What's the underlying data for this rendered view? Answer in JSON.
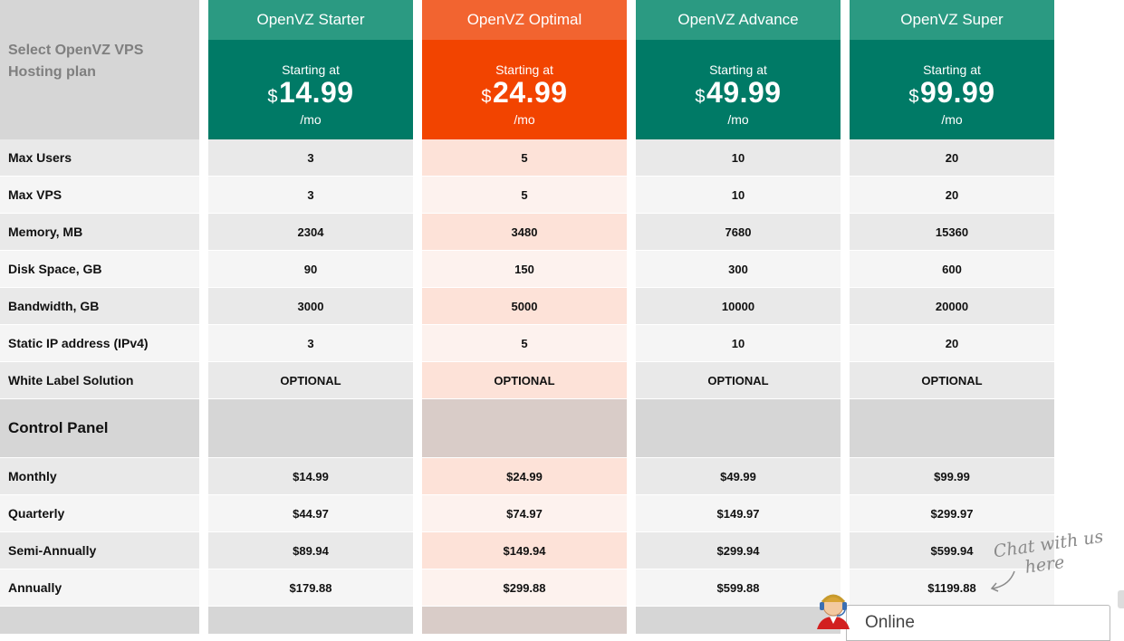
{
  "header": {
    "select_label": "Select OpenVZ VPS Hosting plan"
  },
  "rows": [
    "Max Users",
    "Max VPS",
    "Memory, MB",
    "Disk Space, GB",
    "Bandwidth, GB",
    "Static IP address (IPv4)",
    "White Label Solution"
  ],
  "section_label": "Control Panel",
  "billing_rows": [
    "Monthly",
    "Quarterly",
    "Semi-Annually",
    "Annually"
  ],
  "starting_at": "Starting at",
  "currency": "$",
  "per": "/mo",
  "plans": [
    {
      "name": "OpenVZ Starter",
      "price": "14.99",
      "values": [
        "3",
        "3",
        "2304",
        "90",
        "3000",
        "3",
        "OPTIONAL"
      ],
      "billing": [
        "$14.99",
        "$44.97",
        "$89.94",
        "$179.88"
      ]
    },
    {
      "name": "OpenVZ Optimal",
      "price": "24.99",
      "values": [
        "5",
        "5",
        "3480",
        "150",
        "5000",
        "5",
        "OPTIONAL"
      ],
      "billing": [
        "$24.99",
        "$74.97",
        "$149.94",
        "$299.88"
      ]
    },
    {
      "name": "OpenVZ Advance",
      "price": "49.99",
      "values": [
        "10",
        "10",
        "7680",
        "300",
        "10000",
        "10",
        "OPTIONAL"
      ],
      "billing": [
        "$49.99",
        "$149.97",
        "$299.94",
        "$599.88"
      ]
    },
    {
      "name": "OpenVZ Super",
      "price": "99.99",
      "values": [
        "20",
        "20",
        "15360",
        "600",
        "20000",
        "20",
        "OPTIONAL"
      ],
      "billing": [
        "$99.99",
        "$299.97",
        "$599.94",
        "$1199.88"
      ]
    }
  ],
  "colors": {
    "teal_header": "#2b9a82",
    "teal_price": "#007a66",
    "orange_header": "#f26430",
    "orange_price": "#f24400"
  },
  "chat": {
    "line1": "Chat with us",
    "line2": "here",
    "status": "Online",
    "icon": "support-agent-icon"
  }
}
